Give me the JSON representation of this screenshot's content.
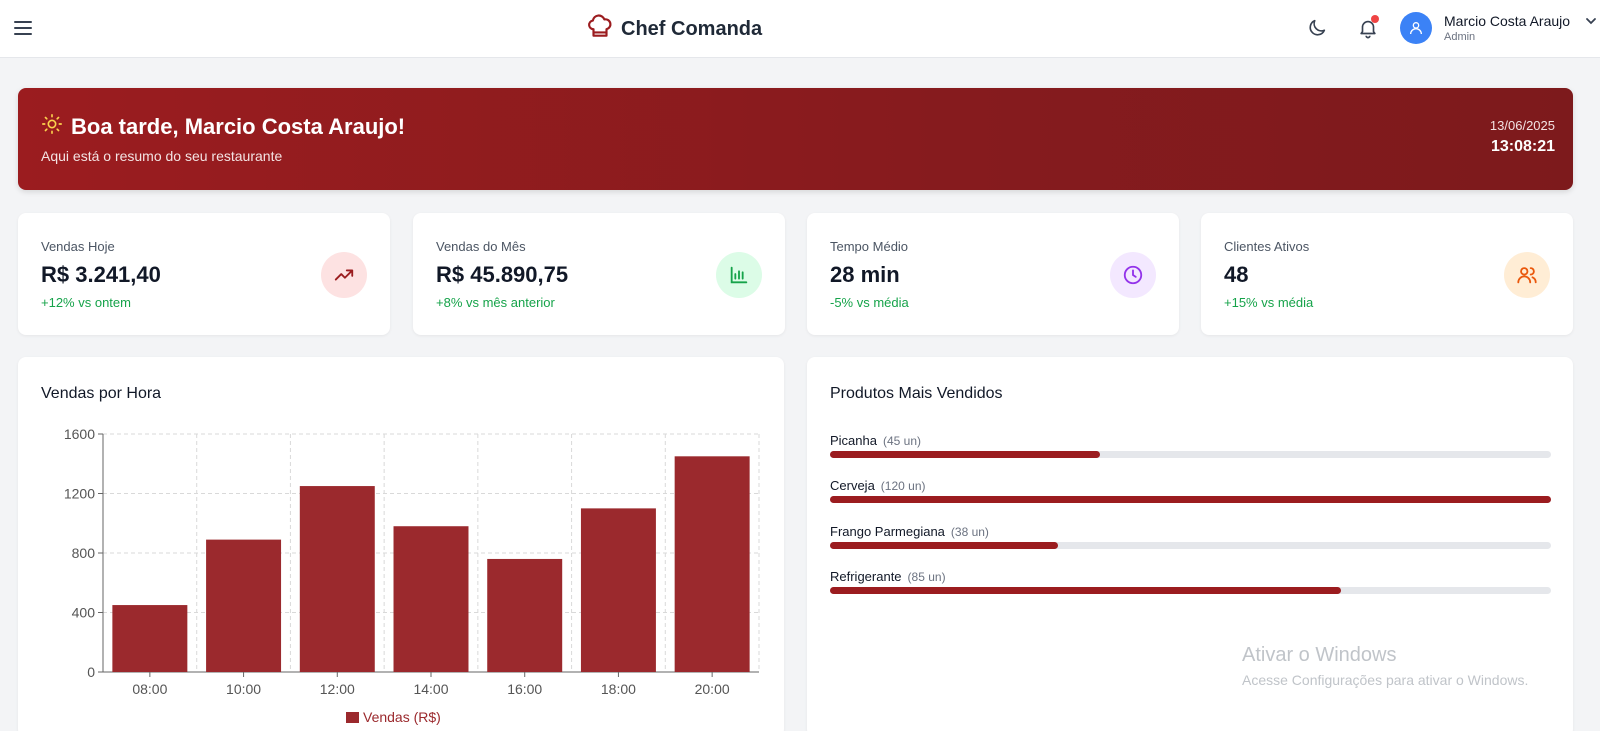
{
  "header": {
    "menu_icon": "hamburger-icon",
    "brand": "Chef Comanda",
    "brand_icon": "chef-hat-icon",
    "theme_icon": "moon-icon",
    "notification_icon": "bell-icon",
    "user_name": "Marcio Costa Araujo",
    "user_role": "Admin"
  },
  "banner": {
    "icon": "sun-icon",
    "greeting": "Boa tarde, Marcio Costa Araujo!",
    "subtitle": "Aqui está o resumo do seu restaurante",
    "date": "13/06/2025",
    "time": "13:08:21"
  },
  "stats": [
    {
      "label": "Vendas Hoje",
      "value": "R$ 3.241,40",
      "delta": "+12% vs ontem",
      "icon": "trending-up-icon",
      "icon_bg": "#fde2e2",
      "icon_color": "#9b1c1f"
    },
    {
      "label": "Vendas do Mês",
      "value": "R$ 45.890,75",
      "delta": "+8% vs mês anterior",
      "icon": "bar-chart-icon",
      "icon_bg": "#dcfce7",
      "icon_color": "#16a34a"
    },
    {
      "label": "Tempo Médio",
      "value": "28 min",
      "delta": "-5% vs média",
      "icon": "clock-icon",
      "icon_bg": "#f3e8ff",
      "icon_color": "#9333ea"
    },
    {
      "label": "Clientes Ativos",
      "value": "48",
      "delta": "+15% vs média",
      "icon": "users-icon",
      "icon_bg": "#ffedd5",
      "icon_color": "#ea580c"
    }
  ],
  "sales_panel": {
    "title": "Vendas por Hora"
  },
  "chart_data": {
    "type": "bar",
    "categories": [
      "08:00",
      "10:00",
      "12:00",
      "14:00",
      "16:00",
      "18:00",
      "20:00"
    ],
    "series": [
      {
        "name": "Vendas (R$)",
        "values": [
          450,
          890,
          1250,
          980,
          760,
          1100,
          1450
        ]
      }
    ],
    "ylim": [
      0,
      1600
    ],
    "yticks": [
      0,
      400,
      800,
      1200,
      1600
    ],
    "grid": true,
    "legend": "bottom",
    "color": "#9b292d"
  },
  "products_panel": {
    "title": "Produtos Mais Vendidos",
    "items": [
      {
        "name": "Picanha",
        "qty_label": "(45 un)",
        "qty": 45
      },
      {
        "name": "Cerveja",
        "qty_label": "(120 un)",
        "qty": 120
      },
      {
        "name": "Frango Parmegiana",
        "qty_label": "(38 un)",
        "qty": 38
      },
      {
        "name": "Refrigerante",
        "qty_label": "(85 un)",
        "qty": 85
      }
    ]
  },
  "watermark": {
    "title": "Ativar o Windows",
    "subtitle": "Acesse Configurações para ativar o Windows."
  }
}
